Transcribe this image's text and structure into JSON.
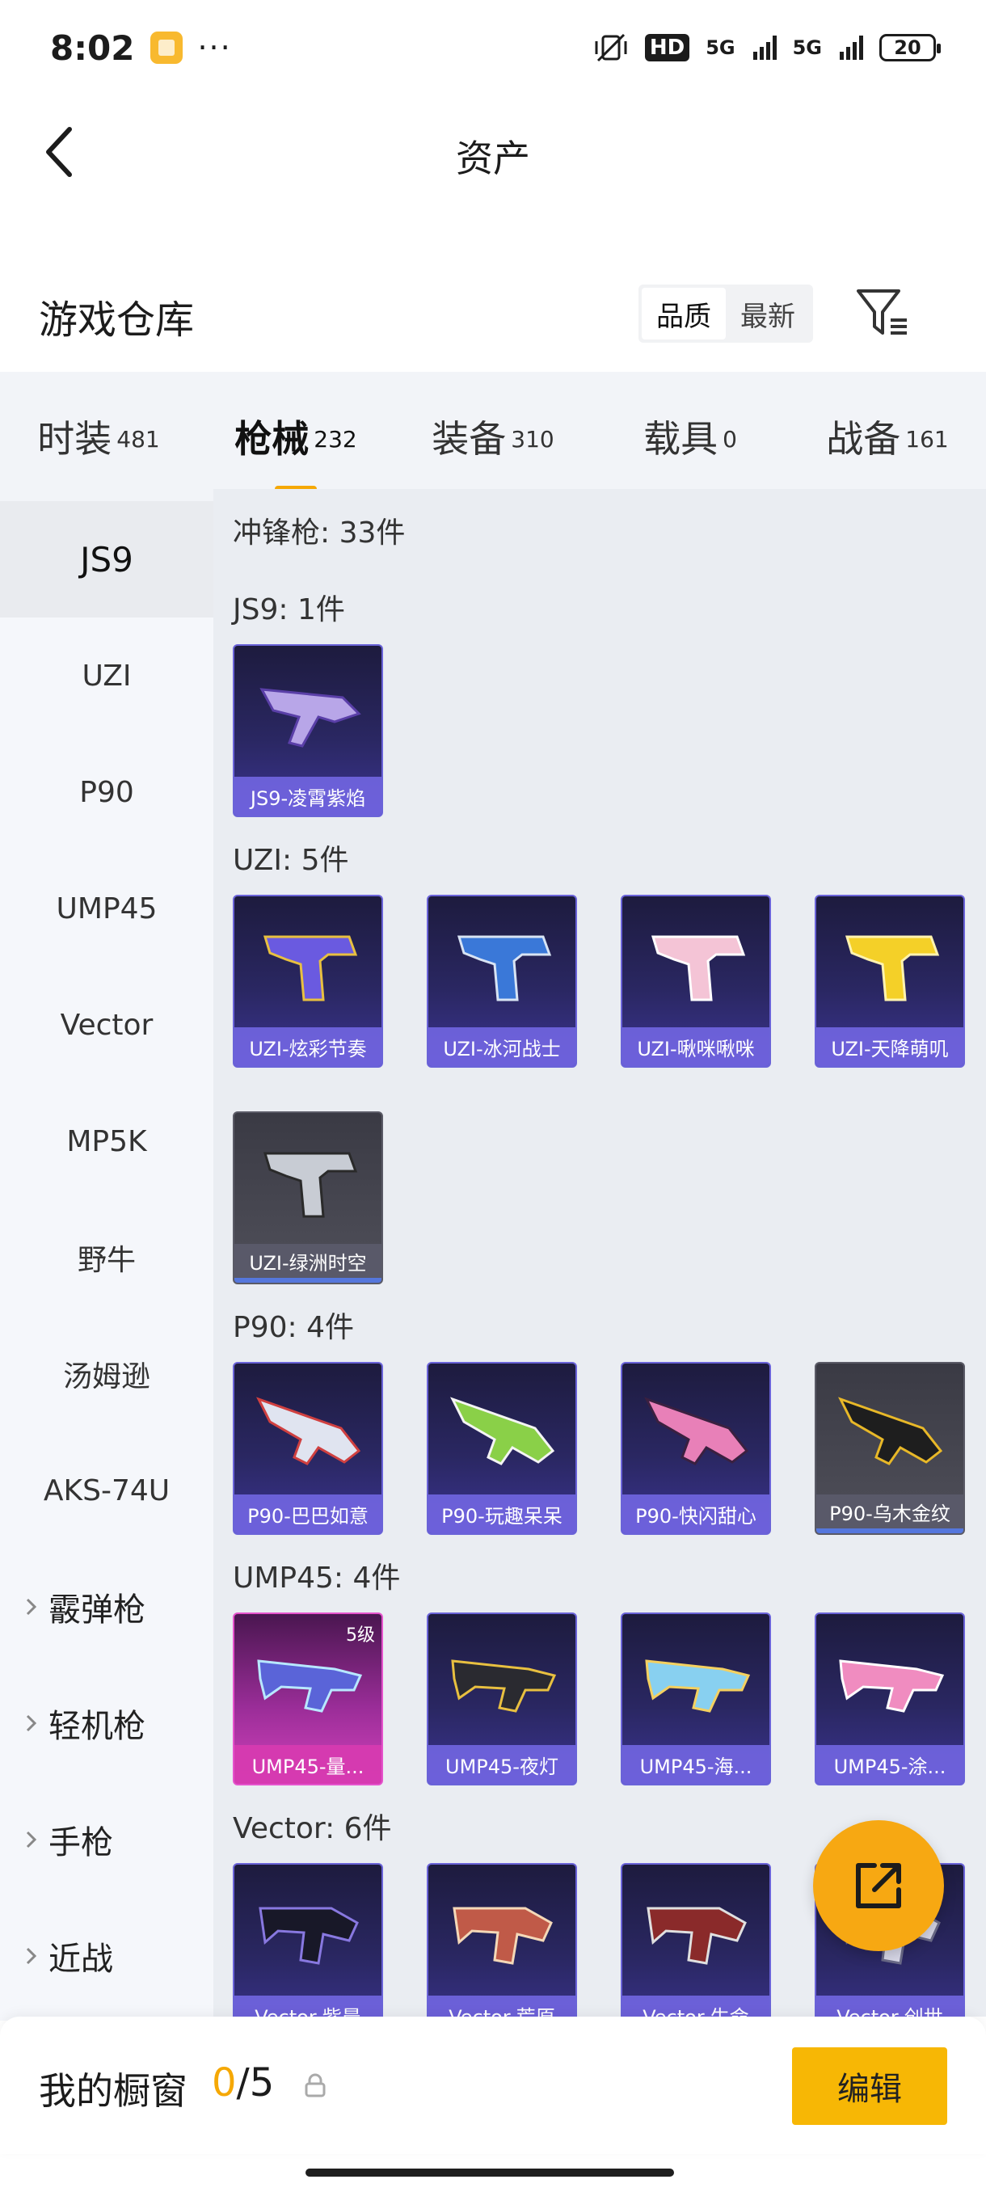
{
  "status_bar": {
    "time": "8:02",
    "dots": "···",
    "hd": "HD",
    "sig1": "5G",
    "sig2": "5G",
    "battery": "20"
  },
  "header": {
    "title": "资产"
  },
  "warehouse": {
    "title": "游戏仓库",
    "sort_options": [
      "品质",
      "最新"
    ]
  },
  "categories": [
    {
      "name": "时装",
      "count": "481"
    },
    {
      "name": "枪械",
      "count": "232"
    },
    {
      "name": "装备",
      "count": "310"
    },
    {
      "name": "载具",
      "count": "0"
    },
    {
      "name": "战备",
      "count": "161"
    }
  ],
  "side_nav": [
    "JS9",
    "UZI",
    "P90",
    "UMP45",
    "Vector",
    "MP5K",
    "野牛",
    "汤姆逊",
    "AKS-74U"
  ],
  "side_groups": [
    "霰弹枪",
    "轻机枪",
    "手枪",
    "近战"
  ],
  "content": {
    "category_title": "冲锋枪: 33件",
    "sections": [
      {
        "title": "JS9: 1件",
        "items": [
          {
            "name": "JS9-凌霄紫焰"
          }
        ]
      },
      {
        "title": "UZI: 5件",
        "items": [
          {
            "name": "UZI-炫彩节奏"
          },
          {
            "name": "UZI-冰河战士"
          },
          {
            "name": "UZI-啾咪啾咪"
          },
          {
            "name": "UZI-天降萌叽"
          },
          {
            "name": "UZI-绿洲时空"
          }
        ]
      },
      {
        "title": "P90: 4件",
        "items": [
          {
            "name": "P90-巴巴如意"
          },
          {
            "name": "P90-玩趣呆呆"
          },
          {
            "name": "P90-快闪甜心"
          },
          {
            "name": "P90-乌木金纹"
          }
        ]
      },
      {
        "title": "UMP45: 4件",
        "items": [
          {
            "name": "UMP45-量...",
            "level": "5级"
          },
          {
            "name": "UMP45-夜灯"
          },
          {
            "name": "UMP45-海..."
          },
          {
            "name": "UMP45-涂..."
          }
        ]
      },
      {
        "title": "Vector: 6件",
        "items": [
          {
            "name": "Vector-紫晨"
          },
          {
            "name": "Vector-荒原"
          },
          {
            "name": "Vector-生命"
          },
          {
            "name": "Vector-创世"
          }
        ]
      }
    ]
  },
  "bottom": {
    "label": "我的橱窗",
    "current": "0",
    "total": "/5",
    "edit_label": "编辑"
  },
  "colors": {
    "accent": "#f5a805",
    "card_purple": "#3b3490",
    "card_gray": "#50505a",
    "card_pink": "#d342bb"
  }
}
